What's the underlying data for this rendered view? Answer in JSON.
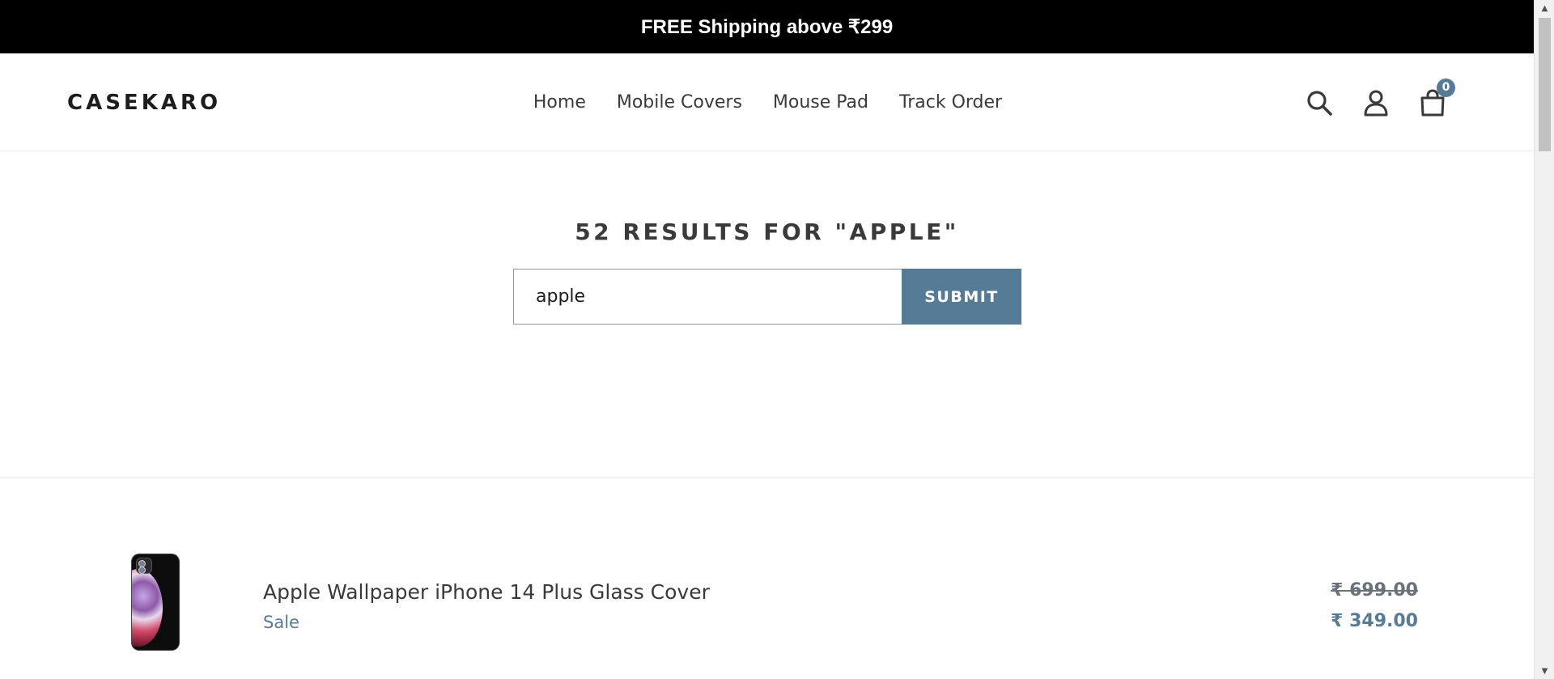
{
  "announcement": {
    "text": "FREE Shipping above ₹299"
  },
  "header": {
    "logo": "CASEKARO",
    "nav": [
      {
        "label": "Home"
      },
      {
        "label": "Mobile Covers"
      },
      {
        "label": "Mouse Pad"
      },
      {
        "label": "Track Order"
      }
    ],
    "icons": {
      "search": "search-icon",
      "account": "account-icon",
      "cart": "cart-icon"
    },
    "cart_count": "0"
  },
  "search": {
    "title": "52 RESULTS FOR \"APPLE\"",
    "query": "apple",
    "submit_label": "SUBMIT"
  },
  "results": [
    {
      "title": "Apple Wallpaper iPhone 14 Plus Glass Cover",
      "badge": "Sale",
      "compare_price": "₹ 699.00",
      "sale_price": "₹ 349.00"
    }
  ],
  "colors": {
    "accent": "#557b97",
    "announcement_bg": "#000000",
    "text": "#3a3a3a"
  }
}
